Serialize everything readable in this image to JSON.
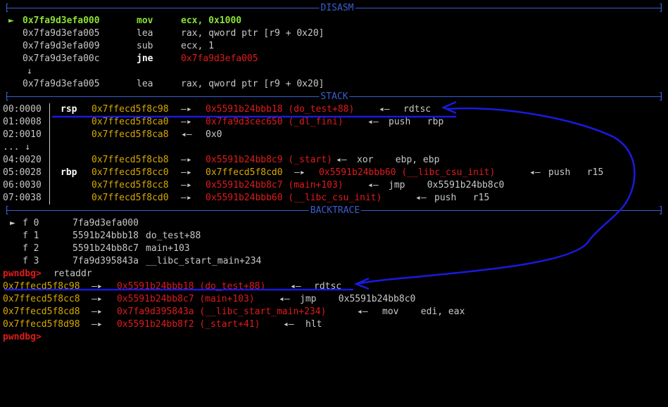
{
  "disasm": {
    "title": "DISASM",
    "rows": [
      {
        "marker": "►",
        "addr": "0x7fa9d3efa000",
        "op": "mov",
        "args": "ecx, 0x1000",
        "current": true
      },
      {
        "marker": "",
        "addr": "0x7fa9d3efa005",
        "op": "lea",
        "args": "rax, qword ptr [r9 + 0x20]",
        "current": false
      },
      {
        "marker": "",
        "addr": "0x7fa9d3efa009",
        "op": "sub",
        "args": "ecx, 1",
        "current": false
      },
      {
        "marker": "",
        "addr": "0x7fa9d3efa00c",
        "op": "jne",
        "args": "0x7fa9d3efa005",
        "current": false,
        "jump": true
      },
      {
        "marker": "↓",
        "addr": "",
        "op": "",
        "args": "",
        "current": false
      },
      {
        "marker": "",
        "addr": "0x7fa9d3efa005",
        "op": "lea",
        "args": "rax, qword ptr [r9 + 0x20]",
        "current": false
      }
    ]
  },
  "stack": {
    "title": "STACK",
    "rows": [
      {
        "off": "00:0000",
        "reg": "rsp",
        "addr": "0x7ffecd5f8c98",
        "arrow1": "—▸",
        "val": "0x5591b24bbb18 (do_test+88)",
        "arrow2": "◂—",
        "ins": "rdtsc"
      },
      {
        "off": "01:0008",
        "reg": "",
        "addr": "0x7ffecd5f8ca0",
        "arrow1": "—▸",
        "val": "0x7fa9d3cec650 (_dl_fini)",
        "arrow2": "◂—",
        "ins": "push   rbp"
      },
      {
        "off": "02:0010",
        "reg": "",
        "addr": "0x7ffecd5f8ca8",
        "arrow1": "◂—",
        "val": "",
        "arrow2": "",
        "ins": "0x0"
      },
      {
        "off": "... ↓",
        "reg": "",
        "addr": "",
        "arrow1": "",
        "val": "",
        "arrow2": "",
        "ins": ""
      },
      {
        "off": "04:0020",
        "reg": "",
        "addr": "0x7ffecd5f8cb8",
        "arrow1": "—▸",
        "val": "0x5591b24bb8c9 (_start)",
        "arrow2": "◂—",
        "ins": "xor    ebp, ebp"
      },
      {
        "off": "05:0028",
        "reg": "rbp",
        "addr": "0x7ffecd5f8cc0",
        "arrow1": "—▸",
        "val": "",
        "mid": "0x7ffecd5f8cd0",
        "arrow3": "—▸",
        "val2": "0x5591b24bbb60 (__libc_csu_init)",
        "arrow2": "◂—",
        "ins": "push   r15"
      },
      {
        "off": "06:0030",
        "reg": "",
        "addr": "0x7ffecd5f8cc8",
        "arrow1": "—▸",
        "val": "0x5591b24bb8c7 (main+103)",
        "arrow2": "◂—",
        "ins": "jmp    0x5591b24bb8c0"
      },
      {
        "off": "07:0038",
        "reg": "",
        "addr": "0x7ffecd5f8cd0",
        "arrow1": "—▸",
        "val": "0x5591b24bbb60 (__libc_csu_init)",
        "arrow2": "◂—",
        "ins": "push   r15"
      }
    ]
  },
  "backtrace": {
    "title": "BACKTRACE",
    "rows": [
      {
        "marker": "►",
        "frame": "f 0",
        "addr": "7fa9d3efa000",
        "sym": ""
      },
      {
        "marker": "",
        "frame": "f 1",
        "addr": "5591b24bbb18",
        "sym": "do_test+88"
      },
      {
        "marker": "",
        "frame": "f 2",
        "addr": "5591b24bb8c7",
        "sym": "main+103"
      },
      {
        "marker": "",
        "frame": "f 3",
        "addr": "7fa9d395843a",
        "sym": "__libc_start_main+234"
      }
    ]
  },
  "prompt": "pwndbg>",
  "command": " retaddr",
  "retaddr_rows": [
    {
      "addr": "0x7ffecd5f8c98",
      "arrow1": "—▸",
      "val": "0x5591b24bbb18 (do_test+88)",
      "arrow2": "◂—",
      "ins": "rdtsc"
    },
    {
      "addr": "0x7ffecd5f8cc8",
      "arrow1": "—▸",
      "val": "0x5591b24bb8c7 (main+103)",
      "arrow2": "◂—",
      "ins": "jmp    0x5591b24bb8c0"
    },
    {
      "addr": "0x7ffecd5f8cd8",
      "arrow1": "—▸",
      "val": "0x7fa9d395843a (__libc_start_main+234)",
      "arrow2": "◂—",
      "ins": "mov    edi, eax"
    },
    {
      "addr": "0x7ffecd5f8d98",
      "arrow1": "—▸",
      "val": "0x5591b24bb8f2 (_start+41)",
      "arrow2": "◂—",
      "ins": "hlt"
    }
  ],
  "colors": {
    "separator": "#3a5ecf",
    "annotation": "#1a1ae0",
    "pointer_red": "#e01b1b",
    "stack_yellow": "#d7a900",
    "current_green": "#8ae234"
  }
}
